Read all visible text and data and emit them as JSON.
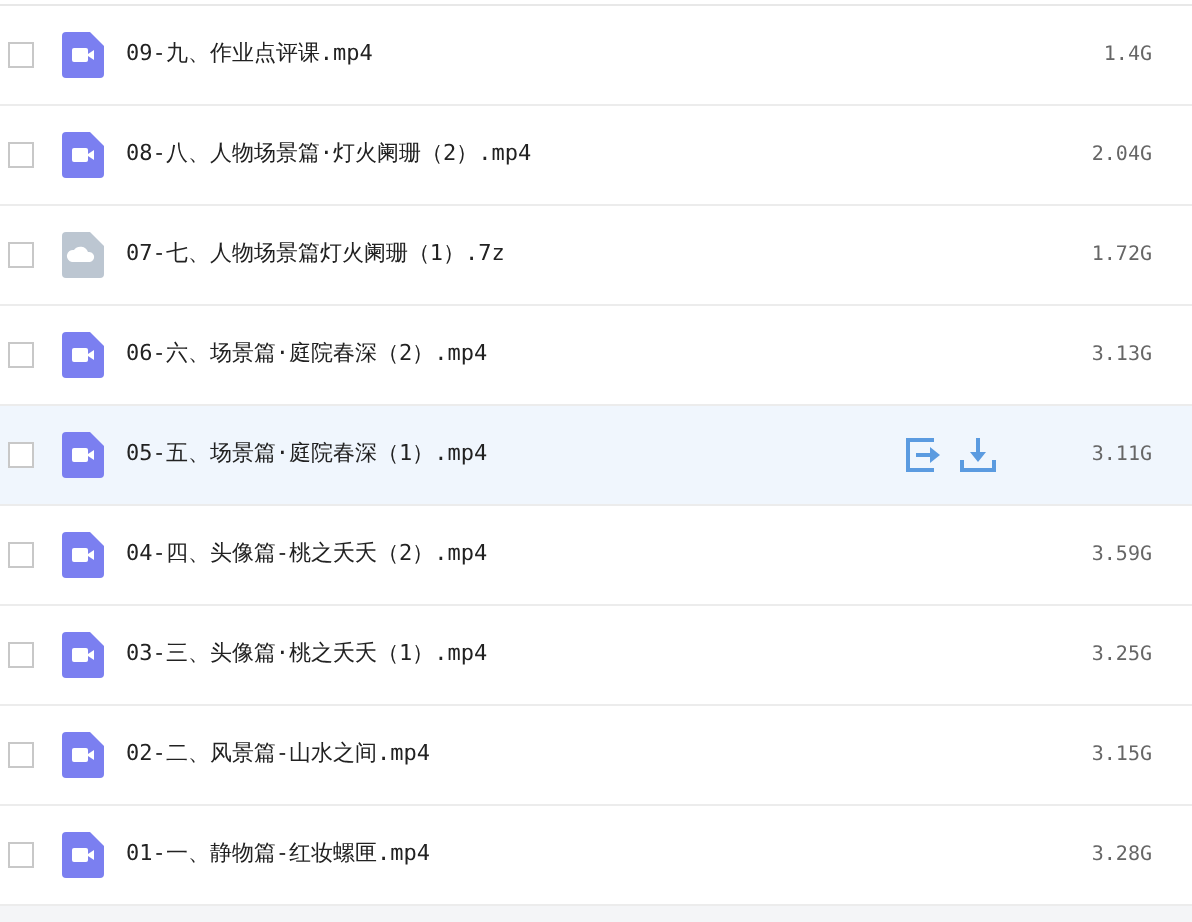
{
  "files": [
    {
      "name": "09-九、作业点评课.mp4",
      "size": "1.4G",
      "kind": "video",
      "checked": false,
      "highlighted": false
    },
    {
      "name": "08-八、人物场景篇·灯火阑珊（2）.mp4",
      "size": "2.04G",
      "kind": "video",
      "checked": false,
      "highlighted": false
    },
    {
      "name": "07-七、人物场景篇灯火阑珊（1）.7z",
      "size": "1.72G",
      "kind": "archive",
      "checked": false,
      "highlighted": false
    },
    {
      "name": "06-六、场景篇·庭院春深（2）.mp4",
      "size": "3.13G",
      "kind": "video",
      "checked": false,
      "highlighted": false
    },
    {
      "name": "05-五、场景篇·庭院春深（1）.mp4",
      "size": "3.11G",
      "kind": "video",
      "checked": false,
      "highlighted": true
    },
    {
      "name": "04-四、头像篇-桃之夭夭（2）.mp4",
      "size": "3.59G",
      "kind": "video",
      "checked": false,
      "highlighted": false
    },
    {
      "name": "03-三、头像篇·桃之夭夭（1）.mp4",
      "size": "3.25G",
      "kind": "video",
      "checked": false,
      "highlighted": false
    },
    {
      "name": "02-二、风景篇-山水之间.mp4",
      "size": "3.15G",
      "kind": "video",
      "checked": false,
      "highlighted": false
    },
    {
      "name": "01-一、静物篇-红妆螺匣.mp4",
      "size": "3.28G",
      "kind": "video",
      "checked": false,
      "highlighted": false
    }
  ]
}
